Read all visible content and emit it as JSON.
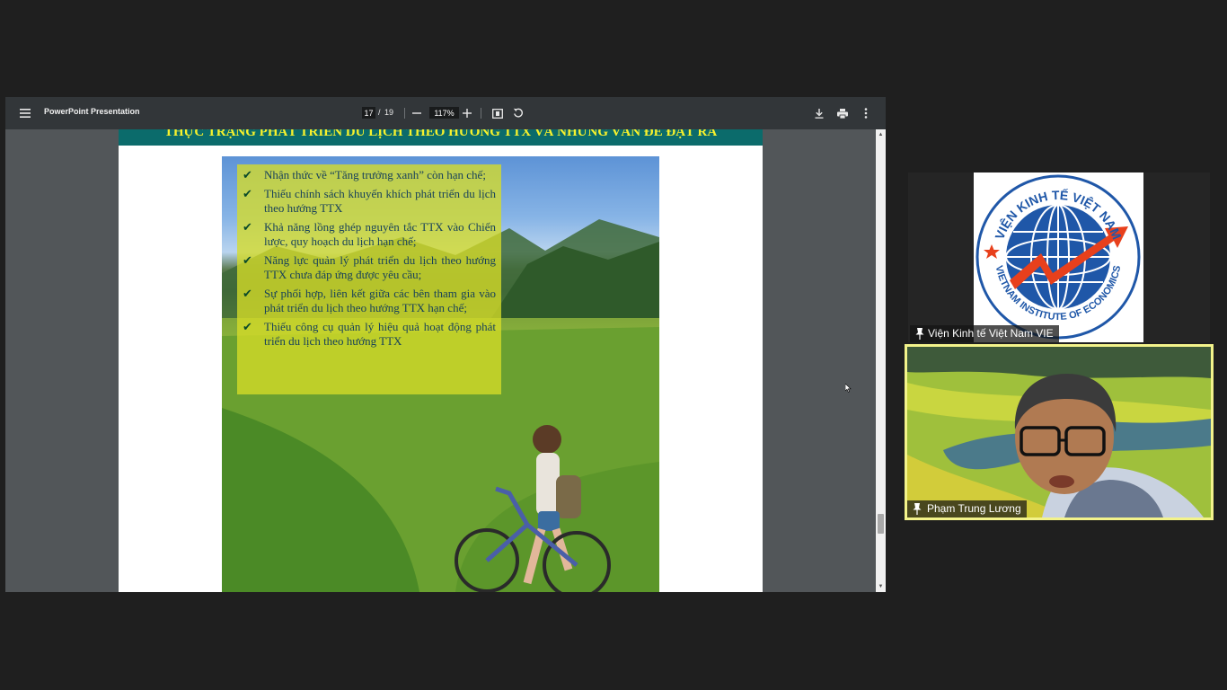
{
  "viewer": {
    "title": "PowerPoint Presentation",
    "current_page": "17",
    "page_separator": "/",
    "total_pages": "19",
    "zoom": "117%",
    "icons": {
      "menu": "hamburger-menu-icon",
      "zoom_out": "minus-icon",
      "zoom_in": "plus-icon",
      "fit_page": "fit-to-page-icon",
      "rotate": "rotate-icon",
      "download": "download-icon",
      "print": "print-icon",
      "more": "more-options-icon"
    }
  },
  "slide": {
    "title": "THỰC TRẠNG PHÁT TRIỂN DU LỊCH THEO HƯỚNG TTX VÀ NHỮNG VẤN ĐỀ ĐẶT RA",
    "title_color": "#f7f12c",
    "header_color": "#0b6b6b",
    "check_mark": "✔",
    "bullets": [
      "Nhận thức về “Tăng trưởng xanh” còn hạn chế;",
      "Thiếu chính sách khuyến khích phát triển du lịch theo hướng TTX",
      "Khả năng lồng ghép nguyên tắc TTX vào Chiến lược, quy hoạch du lịch hạn chế;",
      "Năng lực quản lý phát triển du lịch theo hướng TTX chưa đáp ứng được yêu cầu;",
      "Sự phối hợp, liên kết giữa các bên tham gia vào phát triển du lịch theo hướng TTX hạn chế;",
      "Thiếu công cụ quản lý hiệu quả hoạt động phát triển du lịch theo hướng TTX"
    ]
  },
  "participants": [
    {
      "name": "Viện Kinh tế Việt Nam VIE",
      "logo_text_top": "VIỆN KINH TẾ VIỆT NAM",
      "logo_text_bottom": "VIETNAM INSTITUTE OF ECONOMICS"
    },
    {
      "name": "Phạm Trung Lương",
      "active_border": "#f3f38b"
    }
  ]
}
